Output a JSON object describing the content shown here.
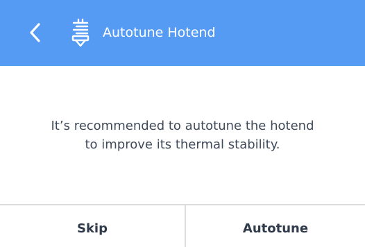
{
  "header": {
    "title": "Autotune Hotend",
    "back_icon": "chevron-left-icon",
    "title_icon": "hotend-nozzle-icon",
    "background_color": "#559bf4"
  },
  "content": {
    "message_line_1": "It’s recommended to autotune the hotend",
    "message_line_2": "to improve its thermal stability."
  },
  "footer": {
    "skip_label": "Skip",
    "autotune_label": "Autotune"
  }
}
